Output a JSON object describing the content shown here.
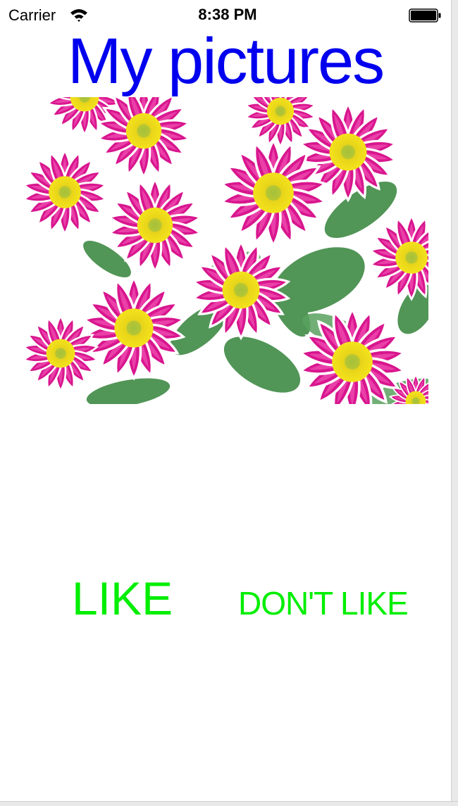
{
  "status_bar": {
    "carrier": "Carrier",
    "time": "8:38 PM",
    "wifi_icon": "wifi-icon",
    "battery_icon": "battery-icon"
  },
  "header": {
    "title": "My pictures",
    "title_color": "#0000ee"
  },
  "photo": {
    "subject": "magenta-daisy-flowers-image"
  },
  "actions": {
    "like_label": "LIKE",
    "dislike_label": "DON'T LIKE",
    "label_color": "#00ee00"
  }
}
